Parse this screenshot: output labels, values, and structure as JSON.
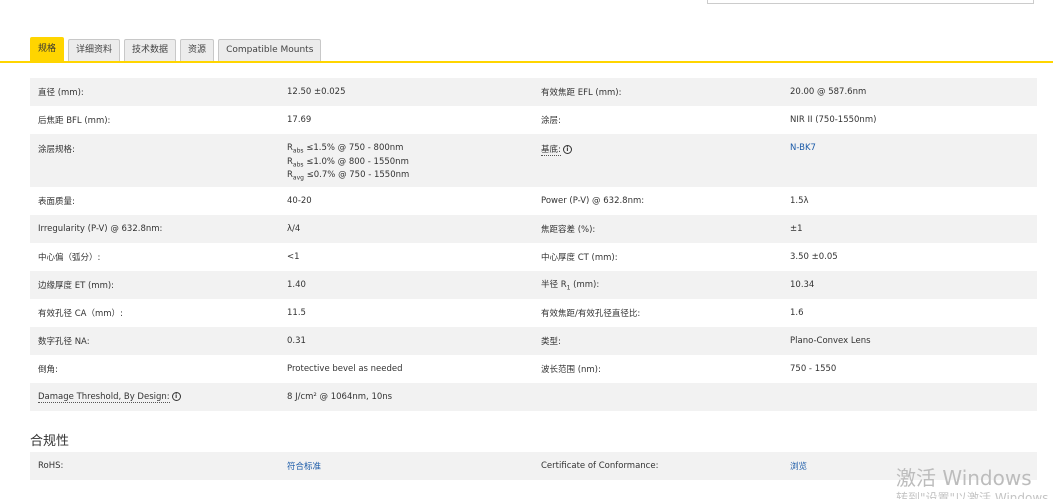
{
  "tabs": [
    "规格",
    "详细资料",
    "技术数据",
    "资源",
    "Compatible Mounts"
  ],
  "specs": {
    "r1": {
      "l1": "直径 (mm):",
      "v1": "12.50 ±0.025",
      "l2": "有效焦距 EFL (mm):",
      "v2": "20.00 @ 587.6nm"
    },
    "r2": {
      "l1": "后焦距 BFL (mm):",
      "v1": "17.69",
      "l2": "涂层:",
      "v2": "NIR II (750-1550nm)"
    },
    "r3": {
      "l1": "涂层规格:",
      "coat": [
        {
          "r": "R",
          "sub": "abs",
          "text": " ≤1.5% @ 750 - 800nm"
        },
        {
          "r": "R",
          "sub": "abs",
          "text": " ≤1.0% @ 800 - 1550nm"
        },
        {
          "r": "R",
          "sub": "avg",
          "text": " ≤0.7% @ 750 - 1550nm"
        }
      ],
      "l2": "基底:",
      "info": "i",
      "v2": "N-BK7"
    },
    "r4": {
      "l1": "表面质量:",
      "v1": "40-20",
      "l2": "Power (P-V) @ 632.8nm:",
      "v2": "1.5λ"
    },
    "r5": {
      "l1": "Irregularity (P-V) @ 632.8nm:",
      "v1": "λ/4",
      "l2": "焦距容差 (%):",
      "v2": "±1"
    },
    "r6": {
      "l1": "中心偏（弧分）:",
      "v1": "<1",
      "l2": "中心厚度 CT (mm):",
      "v2": "3.50 ±0.05"
    },
    "r7": {
      "l1": "边缘厚度 ET (mm):",
      "v1": "1.40",
      "l2a": "半径 R",
      "l2sub": "1",
      "l2b": " (mm):",
      "v2": "10.34"
    },
    "r8": {
      "l1": "有效孔径 CA（mm）:",
      "v1": "11.5",
      "l2": "有效焦距/有效孔径直径比:",
      "v2": "1.6"
    },
    "r9": {
      "l1": "数字孔径 NA:",
      "v1": "0.31",
      "l2": "类型:",
      "v2": "Plano-Convex Lens"
    },
    "r10": {
      "l1": "倒角:",
      "v1": "Protective bevel as needed",
      "l2": "波长范围 (nm):",
      "v2": "750 - 1550"
    },
    "r11": {
      "l1": "Damage Threshold, By Design:",
      "info": "i",
      "v1": "8 J/cm² @ 1064nm, 10ns"
    }
  },
  "compliance": {
    "title": "合规性",
    "rohs_label": "RoHS:",
    "rohs_value": "符合标准",
    "cert_label": "Certificate of Conformance:",
    "cert_value": "浏览"
  },
  "watermark": {
    "line1": "激活 Windows",
    "line2": "转到\"设置\"以激活 Windows。"
  }
}
